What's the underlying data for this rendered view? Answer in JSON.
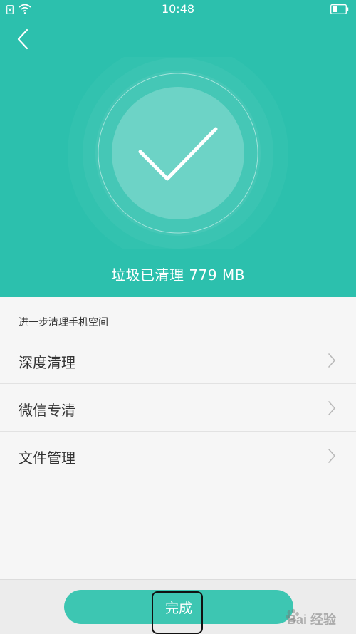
{
  "status_bar": {
    "time": "10:48",
    "icons": [
      "sim-missing-icon",
      "wifi-icon",
      "battery-icon"
    ]
  },
  "hero": {
    "back_icon": "chevron-left-icon",
    "success_icon": "checkmark-icon",
    "result_text": "垃圾已清理 779 MB"
  },
  "section": {
    "title": "进一步清理手机空间"
  },
  "menu": {
    "items": [
      {
        "label": "深度清理",
        "icon": "chevron-right-icon"
      },
      {
        "label": "微信专清",
        "icon": "chevron-right-icon"
      },
      {
        "label": "文件管理",
        "icon": "chevron-right-icon"
      }
    ]
  },
  "footer": {
    "done_label": "完成"
  },
  "watermark": {
    "text": "Bai 经验",
    "icon": "baidu-paw-icon"
  },
  "colors": {
    "accent": "#2cc0ad",
    "button": "#3dc6b2",
    "text": "#333333",
    "background": "#f6f6f6"
  }
}
